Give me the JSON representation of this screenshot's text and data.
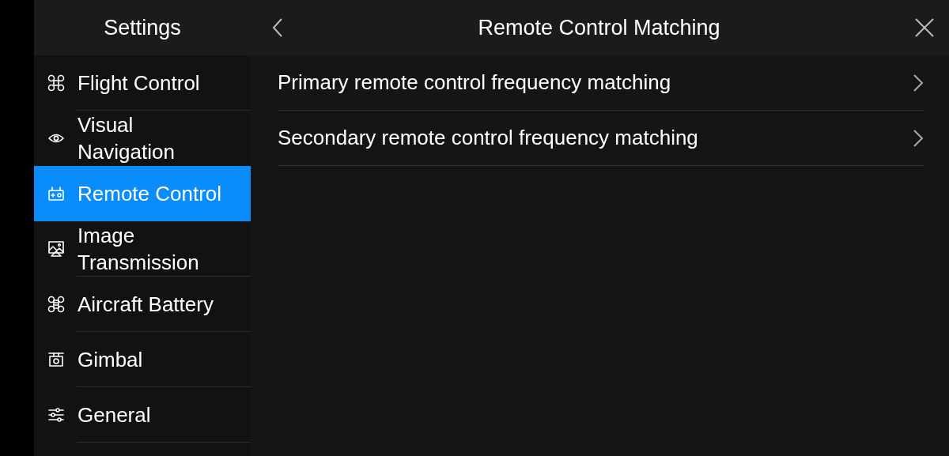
{
  "sidebar": {
    "title": "Settings",
    "items": [
      {
        "label": "Flight Control",
        "selected": false
      },
      {
        "label": "Visual Navigation",
        "selected": false
      },
      {
        "label": "Remote Control",
        "selected": true
      },
      {
        "label": "Image Transmission",
        "selected": false
      },
      {
        "label": "Aircraft Battery",
        "selected": false
      },
      {
        "label": "Gimbal",
        "selected": false
      },
      {
        "label": "General",
        "selected": false
      }
    ]
  },
  "panel": {
    "title": "Remote Control Matching",
    "rows": [
      {
        "label": "Primary remote control frequency matching"
      },
      {
        "label": "Secondary remote control frequency matching"
      }
    ]
  }
}
